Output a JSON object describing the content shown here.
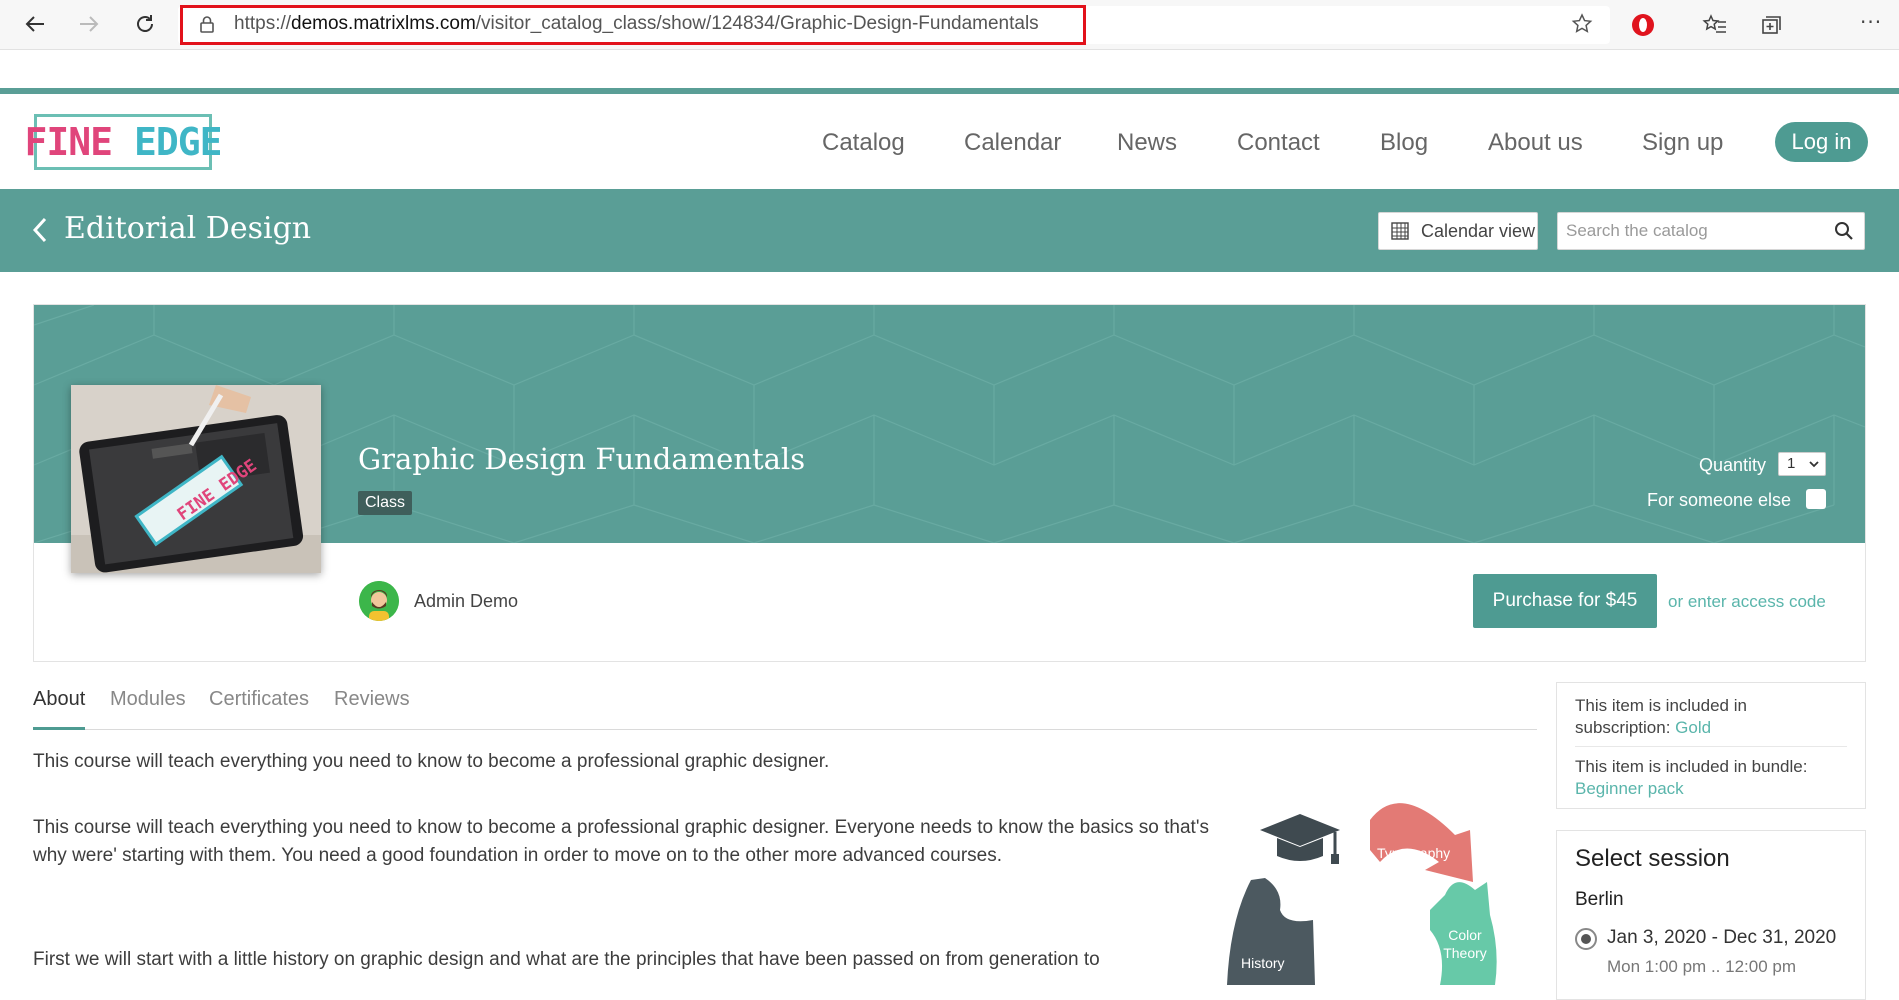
{
  "browser": {
    "url_scheme": "https://",
    "url_host": "demos.matrixlms.com",
    "url_path": "/visitor_catalog_class/show/124834/Graphic-Design-Fundamentals",
    "icons": [
      "back-arrow-icon",
      "forward-arrow-icon",
      "refresh-icon",
      "lock-icon",
      "star-icon",
      "opera-icon",
      "favorites-icon",
      "collections-icon",
      "more-icon"
    ]
  },
  "header": {
    "logo_part1": "FINE",
    "logo_part2": "EDGE",
    "nav": [
      "Catalog",
      "Calendar",
      "News",
      "Contact",
      "Blog",
      "About us",
      "Sign up"
    ],
    "login_label": "Log in"
  },
  "title_bar": {
    "title": "Editorial Design",
    "calendar_view_label": "Calendar view",
    "search_placeholder": "Search the catalog"
  },
  "course": {
    "title": "Graphic Design Fundamentals",
    "type_badge": "Class",
    "quantity_label": "Quantity",
    "quantity_value": "1",
    "for_someone_else_label": "For someone else",
    "for_someone_else_checked": false,
    "author": "Admin Demo",
    "purchase_label": "Purchase for $45",
    "access_code_label": "or enter access code",
    "thumbnail_logo": "FINE EDGE"
  },
  "tabs": [
    {
      "label": "About",
      "active": true
    },
    {
      "label": "Modules",
      "active": false
    },
    {
      "label": "Certificates",
      "active": false
    },
    {
      "label": "Reviews",
      "active": false
    }
  ],
  "about": {
    "paragraph1": "This course will teach everything you need to know to become a professional graphic designer.",
    "paragraph2": "This course will teach everything you need to know to become a professional graphic designer. Everyone needs to know the basics so that's why were' starting with them. You need a good foundation in order to move on to the other more advanced courses.",
    "paragraph3": "First we will start with a little history on graphic design and what are the principles that have been passed on from generation to",
    "infographic_labels": {
      "typography": "Typography",
      "color_theory_line1": "Color",
      "color_theory_line2": "Theory",
      "history": "History"
    }
  },
  "sidebar": {
    "subscription_prefix": "This item is included in subscription:",
    "subscription_link": "Gold",
    "bundle_prefix": "This item is included in bundle:",
    "bundle_link": "Beginner pack",
    "session_title": "Select session",
    "session_city": "Berlin",
    "session_dates": "Jan 3, 2020 - Dec 31, 2020",
    "session_time": "Mon 1:00 pm .. 12:00 pm",
    "session_selected": true
  },
  "colors": {
    "teal": "#5a9e96",
    "teal_dark_button": "#4e9b92",
    "link": "#5ab5ab",
    "url_highlight": "#e2121b",
    "logo_pink": "#e0457b",
    "logo_blue": "#3fb6c6"
  }
}
